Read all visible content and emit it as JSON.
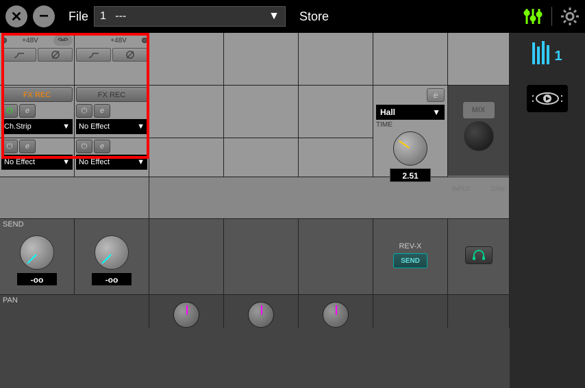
{
  "topbar": {
    "file_label": "File",
    "file_number": "1",
    "file_name": "---",
    "store_label": "Store"
  },
  "channels": {
    "ch1": {
      "phantom": "+48V",
      "fx_rec": "FX REC",
      "effect1": "Ch.Strip",
      "effect2": "No Effect"
    },
    "ch2": {
      "phantom": "+48V",
      "fx_rec": "FX REC",
      "effect1": "No Effect",
      "effect2": "No Effect"
    }
  },
  "reverb": {
    "type": "Hall",
    "time_label": "TIME",
    "time_value": "2.51"
  },
  "master": {
    "mix_label": "MIX",
    "input_label": "INPUT",
    "daw_label": "DAW"
  },
  "send": {
    "label": "SEND",
    "ch1_value": "-oo",
    "ch2_value": "-oo",
    "revx_label": "REV-X",
    "send_btn": "SEND"
  },
  "pan": {
    "label": "PAN"
  },
  "right": {
    "mixer_num": "1"
  }
}
